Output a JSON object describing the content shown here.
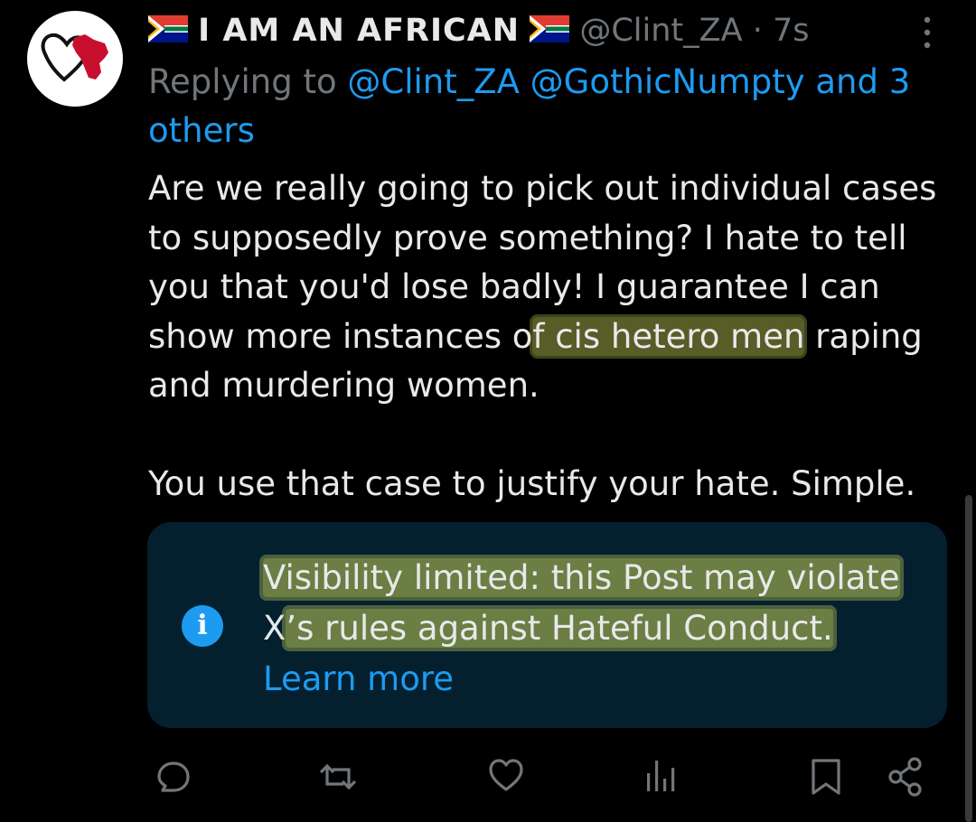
{
  "author": {
    "display_name": "I AM AN AFRICAN",
    "handle": "@Clint_ZA",
    "separator": "·",
    "time": "7s",
    "avatar_icon": "heart-africa-avatar-icon",
    "flag_icon": "south-africa-flag-icon"
  },
  "reply": {
    "prefix": "Replying to",
    "mentions": "@Clint_ZA @GothicNumpty and 3 others"
  },
  "post": {
    "para1_pre": "Are we really going to pick out individual cases to supposedly prove something? I hate to tell you that you'd lose badly! I guarantee I can show more instances o",
    "para1_highlight": "f cis hetero men",
    "para1_post": " raping and murdering women.",
    "para2": "You use that case to justify your hate. Simple."
  },
  "notice": {
    "line1": "Visibility limited: this Post may violate",
    "line2_pre": "X",
    "line2_highlight": "’s rules against Hateful Conduct.",
    "learn_more": "Learn more",
    "icon": "info-icon"
  },
  "actions": [
    "reply-icon",
    "repost-icon",
    "like-icon",
    "views-icon",
    "bookmark-icon",
    "share-icon"
  ],
  "colors": {
    "background": "#000000",
    "text": "#e7e9ea",
    "muted": "#71767b",
    "accent": "#1d9bf0",
    "notice_bg": "#04202e",
    "highlighter": "#d2dc5a"
  }
}
